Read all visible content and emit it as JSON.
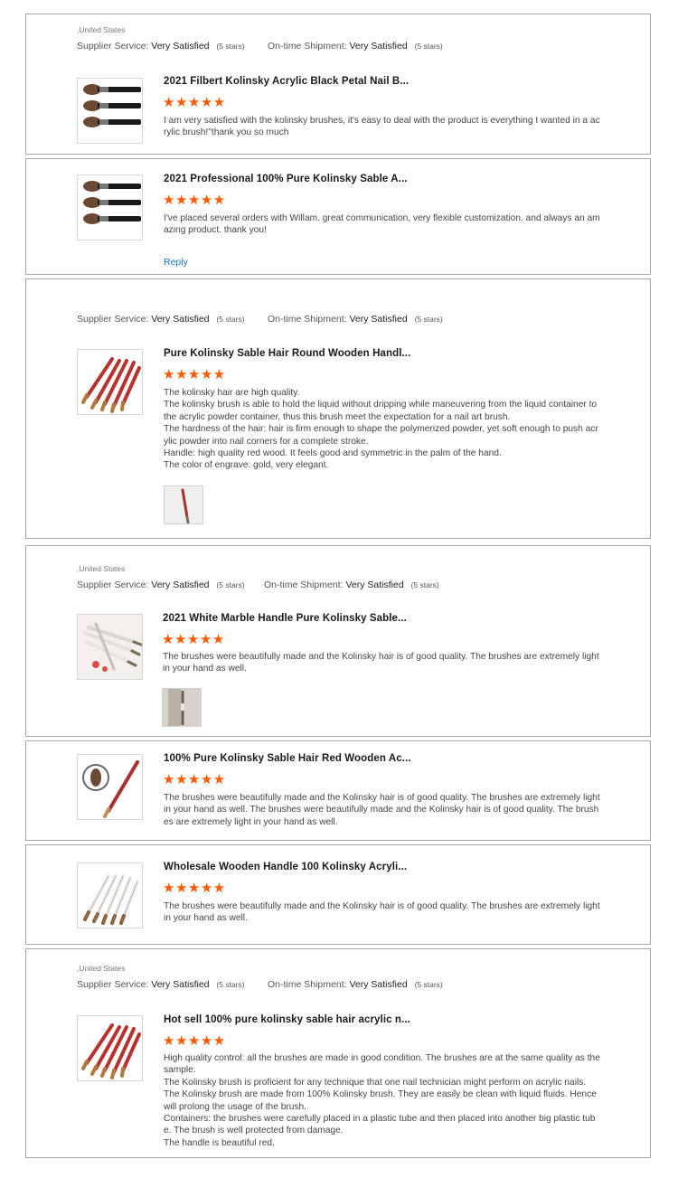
{
  "labels": {
    "supplier_service": "Supplier Service:",
    "ontime_shipment": "On-time Shipment:"
  },
  "colors": {
    "star": "#ff5a00",
    "reply_link": "#1a73c8",
    "card_border": "#a6a6a6"
  },
  "reviews": [
    {
      "country": ",United States",
      "supplier_value": "Very Satisfied",
      "supplier_stars": "(5 stars)",
      "shipment_value": "Very Satisfied",
      "shipment_stars": "(5 stars)",
      "products": [
        {
          "title": "2021 Filbert Kolinsky Acrylic Black Petal Nail B...",
          "rating": 5,
          "stars": "★★★★★",
          "text": "I am very satisfied with the kolinsky brushes, it's easy to deal with the product is everything I wanted in a ac\nrylic brush!\"thank you so much",
          "image_icon": "black-acrylic-brushes-image"
        },
        {
          "title": "2021 Professional 100% Pure Kolinsky Sable A...",
          "rating": 5,
          "stars": "★★★★★",
          "text": "I've placed several orders with Willam. great communication, very flexible customization. and always an am\nazing product. thank you!",
          "image_icon": "black-acrylic-brushes-image",
          "reply": "Reply"
        }
      ]
    },
    {
      "supplier_value": "Very Satisfied",
      "supplier_stars": "(5 stars)",
      "shipment_value": "Very Satisfied",
      "shipment_stars": "(5 stars)",
      "products": [
        {
          "title": "Pure Kolinsky Sable Hair Round Wooden Handl...",
          "rating": 5,
          "stars": "★★★★★",
          "text": "The kolinsky hair are high quality.\nThe kolinsky brush is able to hold the liquid without dripping while maneuvering from the liquid container to\nthe acrylic powder container, thus this brush meet the expectation for a nail art brush.\nThe hardness of the hair: hair is firm enough to shape the polymerized powder, yet soft enough to push acr\nylic powder into nail corners for a complete stroke.\nHandle: high quality red wood. It feels good and symmetric in the palm of the hand.\nThe color of engrave: gold, very elegant.",
          "image_icon": "red-wooden-brushes-image",
          "photo_icon": "customer-photo-red-brush"
        }
      ]
    },
    {
      "country": ",United States",
      "supplier_value": "Very Satisfied",
      "supplier_stars": "(5 stars)",
      "shipment_value": "Very Satisfied",
      "shipment_stars": "(5 stars)",
      "products": [
        {
          "title": "2021 White Marble Handle Pure Kolinsky Sable...",
          "rating": 5,
          "stars": "★★★★★",
          "text": "The brushes were beautifully made and the Kolinsky hair is of good quality. The brushes are extremely light\nin your hand as well.",
          "image_icon": "white-marble-brushes-image",
          "photo_icon": "customer-photo-marble-brush"
        },
        {
          "title": "100% Pure Kolinsky Sable Hair Red Wooden Ac...",
          "rating": 5,
          "stars": "★★★★★",
          "text": "The brushes were beautifully made and the Kolinsky hair is of good quality. The brushes are extremely light\nin your hand as well. The brushes were beautifully made and the Kolinsky hair is of good quality. The brush\nes are extremely light in your hand as well.",
          "image_icon": "red-acrylic-brush-image"
        },
        {
          "title": "Wholesale Wooden Handle 100 Kolinsky Acryli...",
          "rating": 5,
          "stars": "★★★★★",
          "text": "The brushes were beautifully made and the Kolinsky hair is of good quality. The brushes are extremely light\nin your hand as well.",
          "image_icon": "white-wooden-brushes-image"
        }
      ]
    },
    {
      "country": ",United States",
      "supplier_value": "Very Satisfied",
      "supplier_stars": "(5 stars)",
      "shipment_value": "Very Satisfied",
      "shipment_stars": "(5 stars)",
      "products": [
        {
          "title": "Hot sell 100% pure kolinsky sable hair acrylic n...",
          "rating": 5,
          "stars": "★★★★★",
          "text": "High quality control: all the brushes are made in good condition. The brushes are at the same quality as the\nsample.\nThe Kolinsky brush is proficient for any technique that one nail technician might perform on acrylic nails.\nThe Kolinsky brush are made from 100% Kolinsky brush. They are easily be clean with liquid fluids. Hence\nwill prolong the usage of the brush.\nContainers: the brushes were carefully placed in a plastic tube and then placed into another big plastic tub\ne. The brush is well protected from damage.\nThe handle is beautiful red.",
          "image_icon": "red-wooden-brushes-image"
        }
      ]
    }
  ]
}
